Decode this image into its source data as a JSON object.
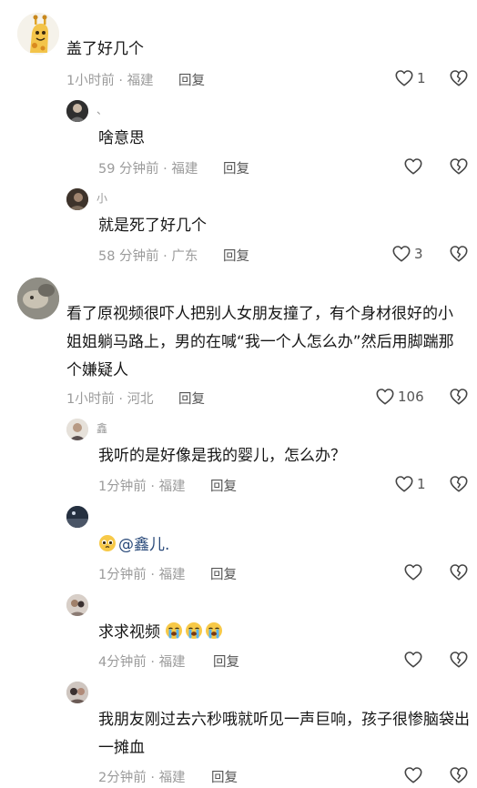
{
  "icons": {
    "like": "heart-outline-icon",
    "dislike": "broken-heart-outline-icon",
    "cry_emoji": "loudly-crying-face-emoji",
    "plead_emoji": "pleading-face-emoji"
  },
  "reply_label": "回复",
  "comments": [
    {
      "text": "盖了好几个",
      "time": "1小时前",
      "location": "福建",
      "likes": "1",
      "replies": [
        {
          "username": "、",
          "text": "啥意思",
          "time": "59 分钟前",
          "location": "福建",
          "likes": ""
        },
        {
          "username": "小",
          "text": "就是死了好几个",
          "time": "58 分钟前",
          "location": "广东",
          "likes": "3"
        }
      ]
    },
    {
      "text": "看了原视频很吓人把别人女朋友撞了，有个身材很好的小姐姐躺马路上，男的在喊“我一个人怎么办”然后用脚踹那个嫌疑人",
      "time": "1小时前",
      "location": "河北",
      "likes": "106",
      "replies": [
        {
          "username": "鑫",
          "text": "我听的是好像是我的婴儿，怎么办？",
          "time": "1分钟前",
          "location": "福建",
          "likes": "1"
        },
        {
          "username": "",
          "mention": "@鑫儿.",
          "time": "1分钟前",
          "location": "福建",
          "likes": ""
        },
        {
          "username": "",
          "text": "求求视频",
          "time": "4分钟前",
          "location": "福建",
          "likes": ""
        },
        {
          "username": "",
          "text": "我朋友刚过去六秒哦就听见一声巨响，孩子很惨脑袋出一摊血",
          "time": "2分钟前",
          "location": "福建",
          "likes": ""
        }
      ]
    }
  ]
}
